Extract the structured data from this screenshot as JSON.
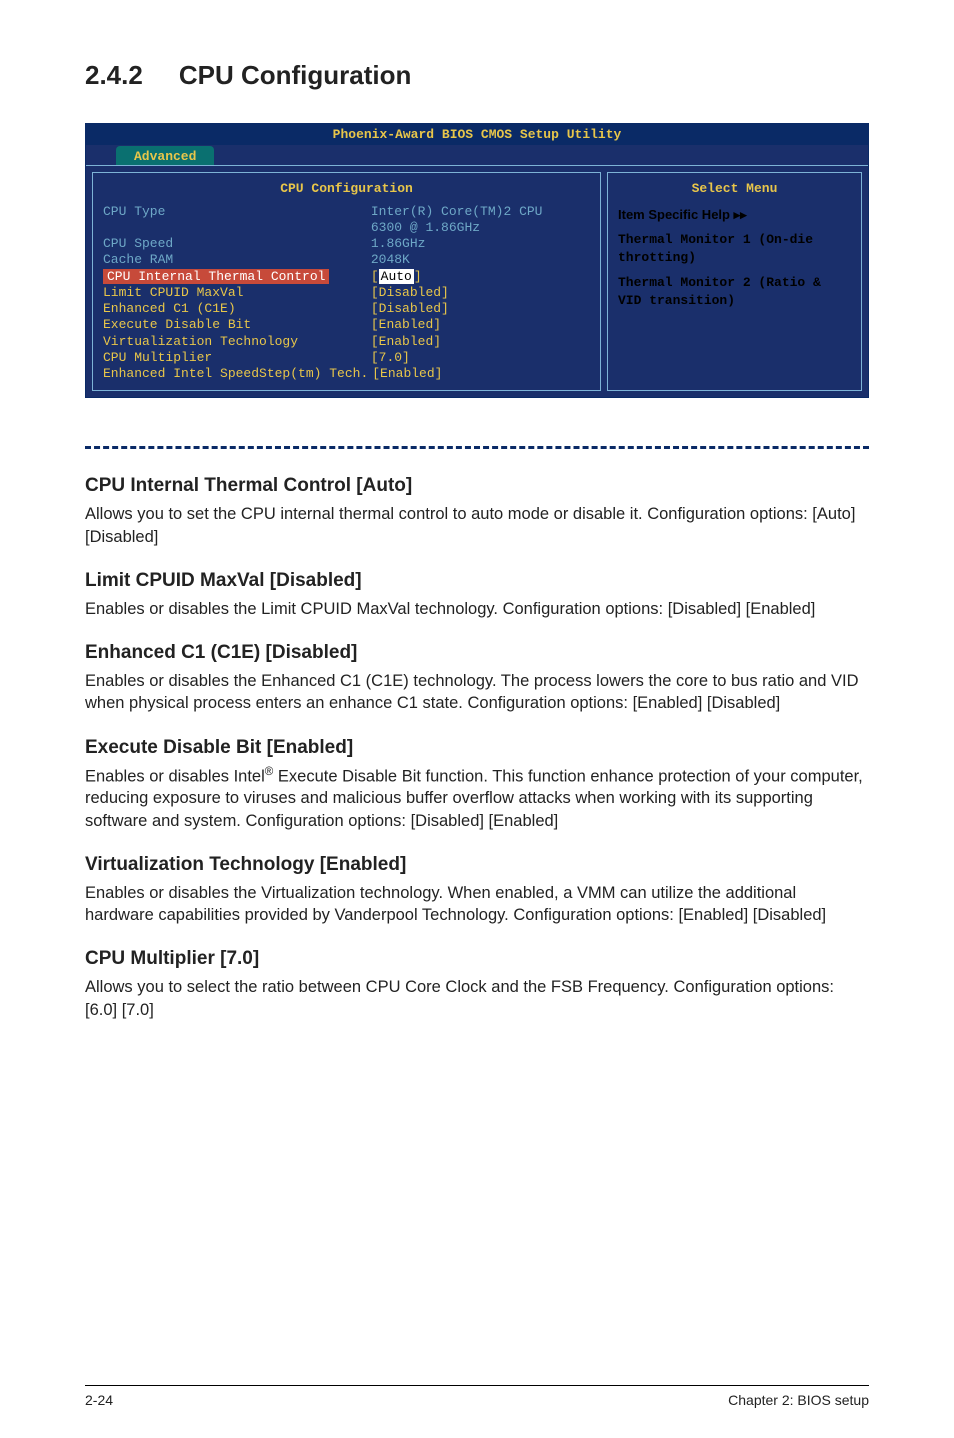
{
  "section_title": {
    "num": "2.4.2",
    "text": "CPU Configuration"
  },
  "bios": {
    "window_title": "Phoenix-Award BIOS CMOS Setup Utility",
    "tab": "Advanced",
    "left_header": "CPU Configuration",
    "right_header": "Select Menu",
    "help": {
      "heading": "Item Specific Help  ▸▸",
      "lines": [
        "Thermal Monitor 1 (On-die throtting)",
        "Thermal Monitor 2 (Ratio & VID transition)"
      ]
    },
    "rows": {
      "cpu_type_label": "CPU Type",
      "cpu_type_val1": "Inter(R) Core(TM)2 CPU",
      "cpu_type_val2": "6300 @ 1.86GHz",
      "cpu_speed_label": "CPU Speed",
      "cpu_speed_val": "1.86GHz",
      "cache_label": "Cache RAM",
      "cache_val": "2048K",
      "thermal_label": "CPU Internal Thermal Control",
      "thermal_val": "Auto",
      "limit_label": "Limit CPUID MaxVal",
      "limit_val": "[Disabled]",
      "c1e_label": "Enhanced C1 (C1E)",
      "c1e_val": "[Disabled]",
      "edb_label": "Execute Disable Bit",
      "edb_val": "[Enabled]",
      "vt_label": "Virtualization Technology",
      "vt_val": "[Enabled]",
      "mult_label": "CPU Multiplier",
      "mult_val": "[7.0]",
      "speedstep_label": "Enhanced Intel SpeedStep(tm) Tech.",
      "speedstep_val": "[Enabled]"
    }
  },
  "subsections": {
    "thermal_h": "CPU Internal Thermal Control [Auto]",
    "thermal_p": "Allows you to set the CPU internal thermal control to auto mode or disable it. Configuration options: [Auto] [Disabled]",
    "limit_h": "Limit CPUID MaxVal [Disabled]",
    "limit_p": "Enables or disables the Limit CPUID MaxVal technology. Configuration options: [Disabled] [Enabled]",
    "c1e_h": "Enhanced C1 (C1E) [Disabled]",
    "c1e_p": "Enables or disables the Enhanced C1 (C1E) technology. The process lowers the core to bus ratio and VID when physical process enters an enhance C1 state. Configuration options: [Enabled] [Disabled]",
    "edb_h": "Execute Disable Bit [Enabled]",
    "edb_p_pre": "Enables or disables Intel",
    "edb_p_post": " Execute Disable Bit function. This function enhance protection of your computer, reducing exposure to viruses and malicious buffer overflow attacks when working with its supporting software and system. Configuration options: [Disabled] [Enabled]",
    "vt_h": "Virtualization Technology [Enabled]",
    "vt_p": "Enables or disables the Virtualization technology. When enabled, a VMM can utilize the additional hardware capabilities provided by Vanderpool Technology. Configuration options: [Enabled] [Disabled]",
    "mult_h": "CPU Multiplier [7.0]",
    "mult_p": "Allows you to select the ratio between CPU Core Clock and the FSB Frequency. Configuration options: [6.0] [7.0]"
  },
  "footer": {
    "page": "2-24",
    "chapter": "Chapter 2: BIOS setup"
  }
}
